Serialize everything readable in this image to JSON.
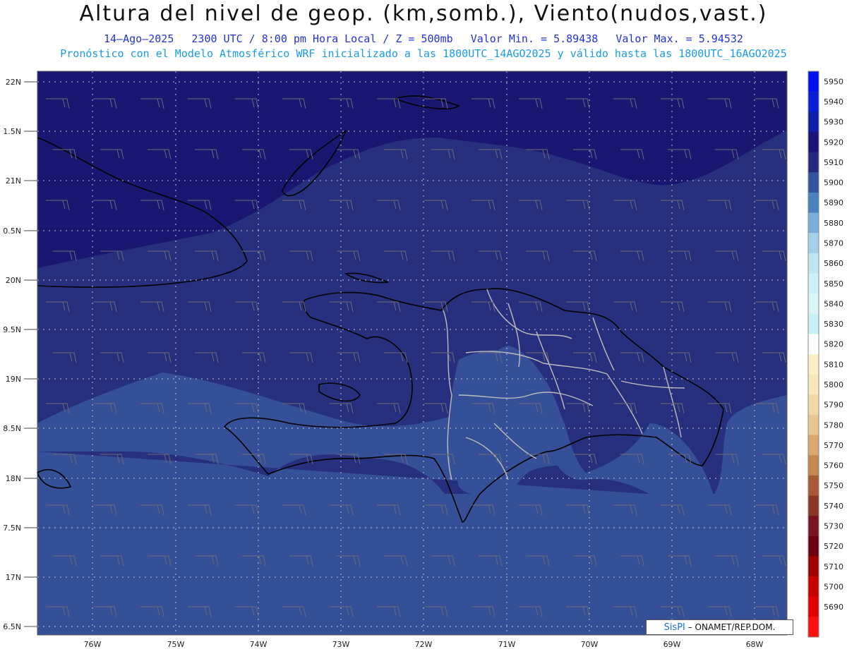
{
  "title": "Altura del nivel de geop. (km,somb.), Viento(nudos,vast.)",
  "subtitle": {
    "date": "14–Ago–2025",
    "time": "2300 UTC / 8:00 pm Hora Local / Z = 500mb",
    "min": "Valor Min. = 5.89438",
    "max": "Valor Max. = 5.94532"
  },
  "model_line": "Pronóstico con el Modelo Atmosférico WRF inicializado a las 1800UTC_14AGO2025 y válido hasta las  1800UTC_16AGO2025",
  "axes": {
    "lat_labels": [
      "22N",
      "1.5N",
      "21N",
      "0.5N",
      "20N",
      "9.5N",
      "19N",
      "8.5N",
      "18N",
      "7.5N",
      "17N",
      "6.5N"
    ],
    "lon_labels": [
      "76W",
      "75W",
      "74W",
      "73W",
      "72W",
      "71W",
      "70W",
      "69W",
      "68W"
    ]
  },
  "colorbar": {
    "levels": [
      "5950",
      "5940",
      "5930",
      "5920",
      "5910",
      "5900",
      "5890",
      "5880",
      "5870",
      "5860",
      "5850",
      "5840",
      "5830",
      "5820",
      "5810",
      "5800",
      "5790",
      "5780",
      "5770",
      "5760",
      "5750",
      "5740",
      "5730",
      "5720",
      "5710",
      "5700",
      "5690"
    ],
    "colors": [
      "#0010f0",
      "#0a1ed8",
      "#0f1fa8",
      "#1a157a",
      "#26277f",
      "#33549d",
      "#4a82c0",
      "#7aaed8",
      "#a6d0e8",
      "#bfe6f0",
      "#cdeef6",
      "#dbf4f8",
      "#c8f0f4",
      "#ffffff",
      "#faf0c8",
      "#f6e6b8",
      "#f0d8a8",
      "#e8c690",
      "#d8a870",
      "#c48850",
      "#a85a36",
      "#8a3626",
      "#7a1420",
      "#6a0010",
      "#a00000",
      "#c80000",
      "#e00000",
      "#ff1010"
    ]
  },
  "map_colors": {
    "north": "#1a1773",
    "middle": "#27307f",
    "south": "#354f98",
    "coast": "#000000",
    "borders": "#bdbdbd"
  },
  "credit": {
    "logo": "SisPI",
    "text": "– ONAMET/REP.DOM."
  }
}
